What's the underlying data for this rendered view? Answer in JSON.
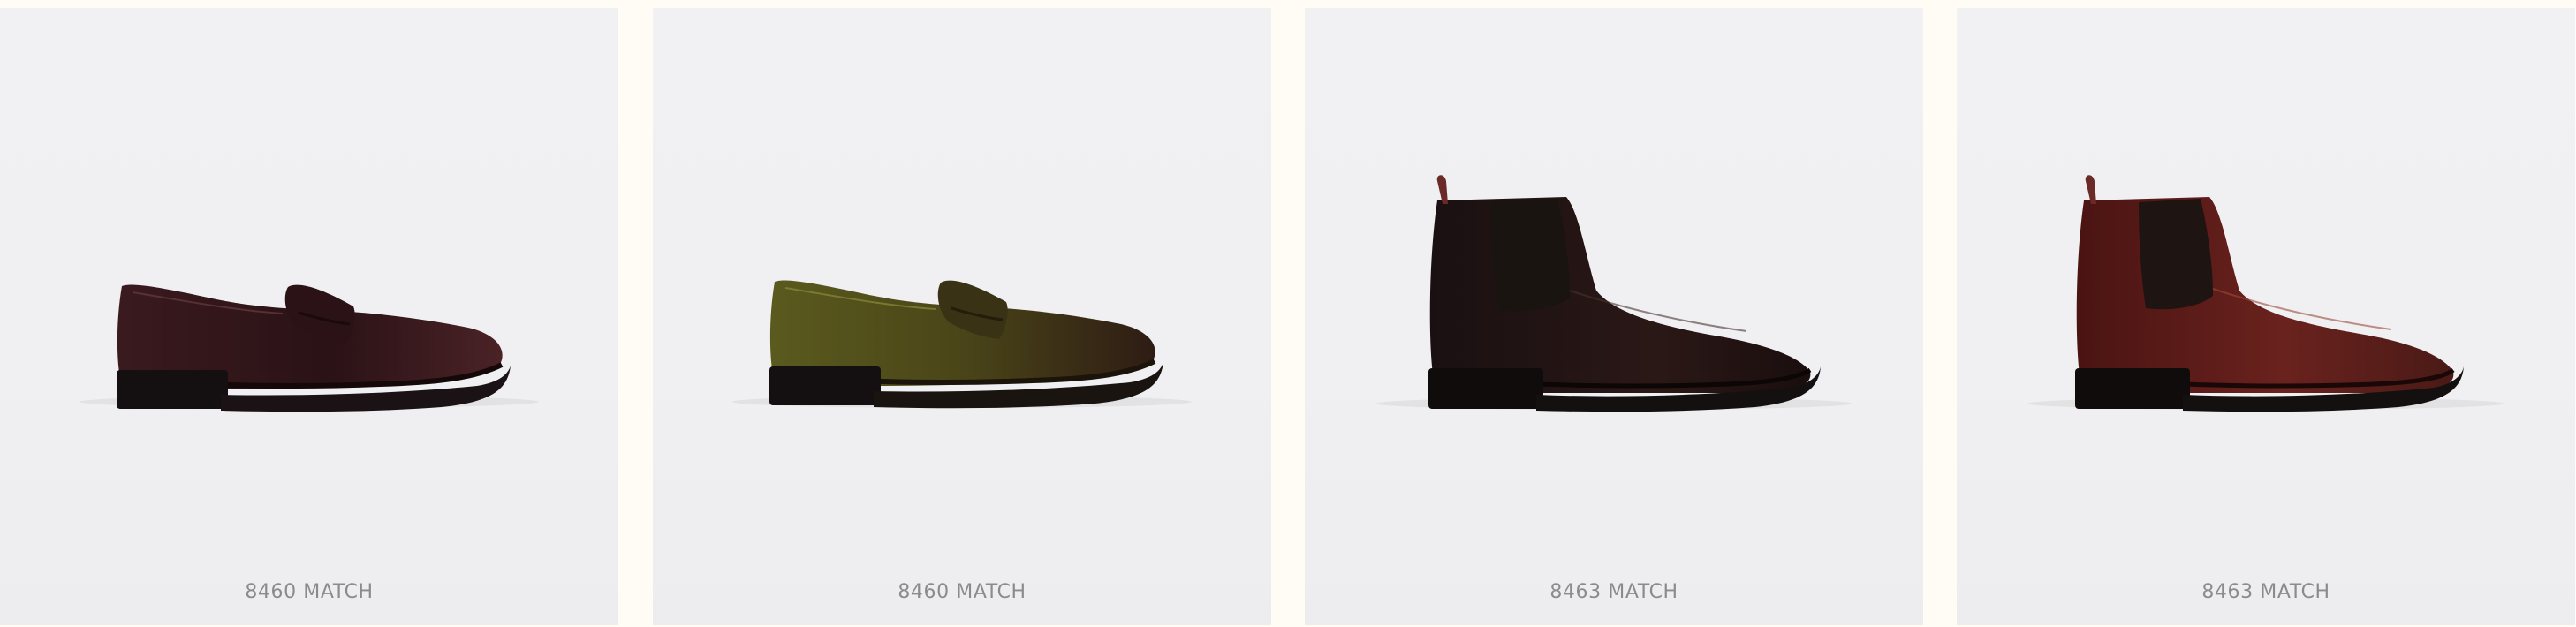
{
  "products": [
    {
      "caption": "8460 MATCH",
      "icon": "loafer-shoe-image",
      "colors": {
        "dark": "#1e1214",
        "mid": "#3a1a1e",
        "light": "#6b3a3f"
      }
    },
    {
      "caption": "8460 MATCH",
      "icon": "loafer-shoe-image",
      "colors": {
        "dark": "#2a2412",
        "mid": "#4a4518",
        "light": "#7a7a2e"
      }
    },
    {
      "caption": "8463 MATCH",
      "icon": "chelsea-boot-image",
      "colors": {
        "dark": "#140c0c",
        "mid": "#2a1816",
        "light": "#5a3a36"
      }
    },
    {
      "caption": "8463 MATCH",
      "icon": "chelsea-boot-image",
      "colors": {
        "dark": "#2a0c0c",
        "mid": "#5a1a18",
        "light": "#8a3a30"
      }
    }
  ]
}
